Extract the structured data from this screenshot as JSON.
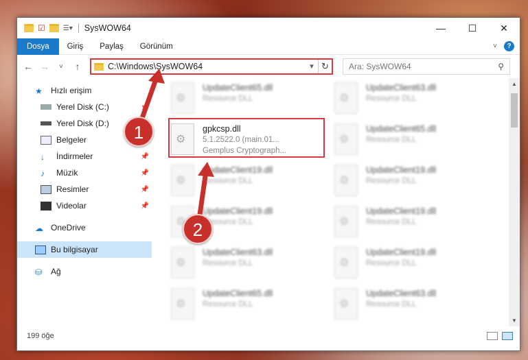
{
  "window": {
    "title": "SysWOW64"
  },
  "ribbon": {
    "tabs": [
      "Dosya",
      "Giriş",
      "Paylaş",
      "Görünüm"
    ],
    "help": "?"
  },
  "nav": {
    "back": "←",
    "forward": "→",
    "recent": "˅",
    "up": "↑"
  },
  "address": {
    "path": "C:\\Windows\\SysWOW64",
    "refresh": "↻"
  },
  "search": {
    "placeholder": "Ara: SysWOW64"
  },
  "sidebar": {
    "quick_access": "Hızlı erişim",
    "items": [
      {
        "label": "Yerel Disk (C:)"
      },
      {
        "label": "Yerel Disk (D:)"
      },
      {
        "label": "Belgeler"
      },
      {
        "label": "İndirmeler"
      },
      {
        "label": "Müzik"
      },
      {
        "label": "Resimler"
      },
      {
        "label": "Videolar"
      }
    ],
    "onedrive": "OneDrive",
    "this_pc": "Bu bilgisayar",
    "network": "Ağ"
  },
  "files": {
    "selected": {
      "name": "gpkcsp.dll",
      "version": "5.1.2522.0 (main.01...",
      "desc": "Gemplus Cryptograph..."
    },
    "blurred": [
      {
        "name": "UpdateClient65.dll",
        "desc": "Resource DLL"
      },
      {
        "name": "UpdateClient63.dll",
        "desc": "Resource DLL"
      },
      {
        "name": "UpdateClient65.dll",
        "desc": "Resource DLL"
      },
      {
        "name": "UpdateClient19.dll",
        "desc": "Resource DLL"
      },
      {
        "name": "UpdateClient19.dll",
        "desc": "Resource DLL"
      },
      {
        "name": "UpdateClient19.dll",
        "desc": "Resource DLL"
      },
      {
        "name": "UpdateClient19.dll",
        "desc": "Resource DLL"
      },
      {
        "name": "UpdateClient63.dll",
        "desc": "Resource DLL"
      },
      {
        "name": "UpdateClient19.dll",
        "desc": "Resource DLL"
      },
      {
        "name": "UpdateClient65.dll",
        "desc": "Resource DLL"
      },
      {
        "name": "UpdateClient63.dll",
        "desc": "Resource DLL"
      }
    ]
  },
  "status": {
    "count": "199 öğe"
  },
  "annotations": {
    "step1": "1",
    "step2": "2"
  },
  "colors": {
    "accent": "#1979ca",
    "highlight": "#d9363e",
    "badge": "#c8302c"
  }
}
